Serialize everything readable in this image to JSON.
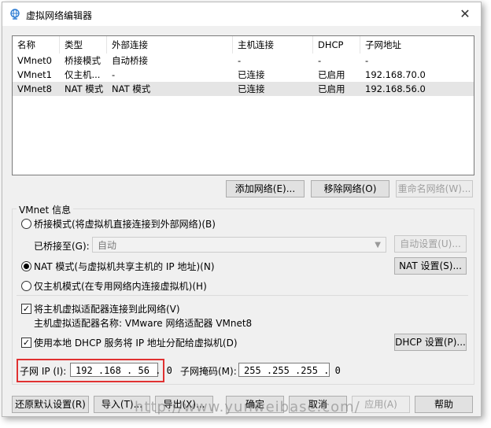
{
  "window": {
    "title": "虚拟网络编辑器",
    "close_glyph": "✕"
  },
  "network_list": {
    "columns": [
      "名称",
      "类型",
      "外部连接",
      "主机连接",
      "DHCP",
      "子网地址"
    ],
    "rows": [
      [
        "VMnet0",
        "桥接模式",
        "自动桥接",
        "-",
        "-",
        "-"
      ],
      [
        "VMnet1",
        "仅主机...",
        "-",
        "已连接",
        "已启用",
        "192.168.70.0"
      ],
      [
        "VMnet8",
        "NAT 模式",
        "NAT 模式",
        "已连接",
        "已启用",
        "192.168.56.0"
      ]
    ],
    "selected_row": 2
  },
  "list_buttons": {
    "add": "添加网络(E)...",
    "remove": "移除网络(O)",
    "rename": "重命名网络(W)..."
  },
  "vmnet_info": {
    "legend": "VMnet 信息",
    "bridged_label": "桥接模式(将虚拟机直接连接到外部网络)(B)",
    "bridged_to_label": "已桥接至(G):",
    "bridged_to_value": "自动",
    "auto_settings": "自动设置(U)...",
    "nat_label": "NAT 模式(与虚拟机共享主机的 IP 地址)(N)",
    "nat_settings": "NAT 设置(S)...",
    "hostonly_label": "仅主机模式(在专用网络内连接虚拟机)(H)",
    "selected_mode": "nat",
    "connect_adapter_label": "将主机虚拟适配器连接到此网络(V)",
    "connect_adapter_checked": true,
    "adapter_name_label": "主机虚拟适配器名称: VMware 网络适配器 VMnet8",
    "dhcp_label": "使用本地 DHCP 服务将 IP 地址分配给虚拟机(D)",
    "dhcp_checked": true,
    "dhcp_settings": "DHCP 设置(P)...",
    "subnet_ip_label": "子网 IP (I):",
    "subnet_ip_value": "192 .168 . 56 . 0",
    "subnet_mask_label": "子网掩码(M):",
    "subnet_mask_value": "255 .255 .255 . 0"
  },
  "footer_buttons": {
    "restore": "还原默认设置(R)",
    "import": "导入(T)...",
    "export": "导出(X)...",
    "ok": "确定",
    "cancel": "取消",
    "apply": "应用(A)",
    "help": "帮助"
  },
  "watermark": "http://www.yunweibase.com/",
  "colors": {
    "highlight": "#e03131",
    "selected_row": "#e5e5e5"
  }
}
